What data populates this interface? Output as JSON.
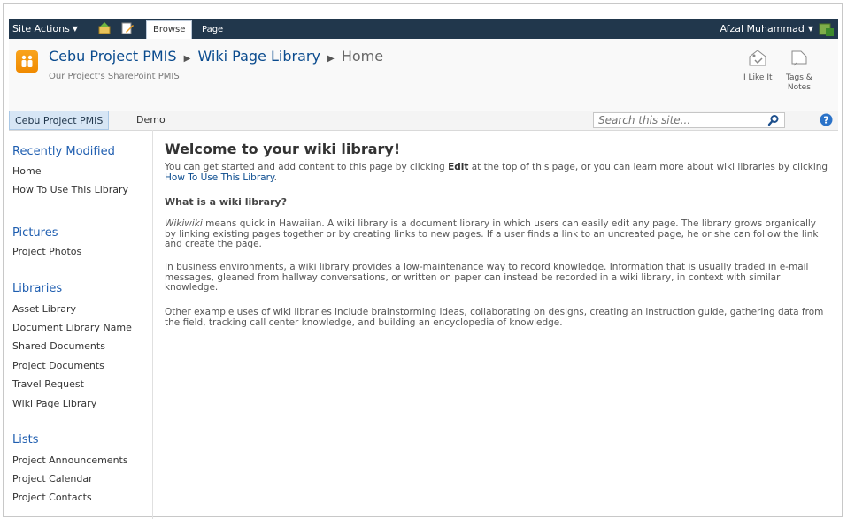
{
  "ribbon": {
    "site_actions": "Site Actions",
    "tabs": [
      {
        "label": "Browse",
        "active": true
      },
      {
        "label": "Page",
        "active": false
      }
    ],
    "user": "Afzal Muhammad"
  },
  "header": {
    "breadcrumb": [
      "Cebu Project PMIS",
      "Wiki Page Library",
      "Home"
    ],
    "description": "Our Project's SharePoint PMIS",
    "i_like_it": "I Like It",
    "tags_notes": "Tags &\nNotes"
  },
  "topnav": {
    "items": [
      {
        "label": "Cebu Project PMIS",
        "selected": true
      },
      {
        "label": "Demo",
        "selected": false
      }
    ],
    "search_placeholder": "Search this site..."
  },
  "sidebar": {
    "recently_modified": {
      "heading": "Recently Modified",
      "items": [
        "Home",
        "How To Use This Library"
      ]
    },
    "pictures": {
      "heading": "Pictures",
      "items": [
        "Project Photos"
      ]
    },
    "libraries": {
      "heading": "Libraries",
      "items": [
        "Asset Library",
        "Document Library Name",
        "Shared Documents",
        "Project Documents",
        "Travel Request",
        "Wiki Page Library"
      ]
    },
    "lists": {
      "heading": "Lists",
      "items": [
        "Project Announcements",
        "Project Calendar",
        "Project Contacts"
      ]
    }
  },
  "main": {
    "title": "Welcome to your wiki library!",
    "intro_a": "You can get started and add content to this page by clicking ",
    "intro_edit": "Edit",
    "intro_b": " at the top of this page, or you can learn more about wiki libraries by clicking ",
    "intro_link": "How To Use This Library",
    "intro_c": ".",
    "subheading": "What is a wiki library?",
    "para1_em": "Wikiwiki",
    "para1": " means quick in Hawaiian. A wiki library is a document library in which users can easily edit any page. The library grows organically by linking existing pages together or by creating links to new pages. If a user finds a link to an uncreated page, he or she can follow the link and create the page.",
    "para2": "In business environments, a wiki library provides a low-maintenance way to record knowledge. Information that is usually traded in e-mail messages, gleaned from hallway conversations, or written on paper can instead be recorded in a wiki library, in context with similar knowledge.",
    "para3": "Other example uses of wiki libraries include brainstorming ideas, collaborating on designs, creating an instruction guide, gathering data from the field, tracking call center knowledge, and building an encyclopedia of knowledge."
  }
}
